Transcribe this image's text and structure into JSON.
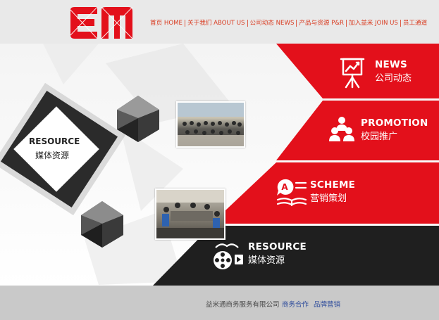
{
  "header": {
    "nav": [
      {
        "label": "首页 HOME"
      },
      {
        "label": "关于我们 ABOUT US"
      },
      {
        "label": "公司动态 NEWS"
      },
      {
        "label": "产品与资源 P&R"
      },
      {
        "label": "加入益米 JOIN US"
      },
      {
        "label": "员工通道"
      }
    ]
  },
  "panels": {
    "news": {
      "title": "NEWS",
      "subtitle": "公司动态"
    },
    "promotion": {
      "title": "PROMOTION",
      "subtitle": "校园推广"
    },
    "scheme": {
      "title": "SCHEME",
      "subtitle": "营销策划"
    },
    "resource": {
      "title": "RESOURCE",
      "subtitle": "媒体资源"
    }
  },
  "resource_block": {
    "title": "RESOURCE",
    "subtitle": "媒体资源"
  },
  "footer": {
    "company": "益米通商务服务有限公司",
    "links": [
      {
        "label": "商务合作"
      },
      {
        "label": "品牌营销"
      }
    ]
  },
  "colors": {
    "accent_red": "#e3101b",
    "dark": "#222222",
    "nav_text": "#d93a1f",
    "footer_bg": "#c9c9c9",
    "footer_link": "#2f4d9c"
  },
  "icons": {
    "news": "presentation-board-icon",
    "promotion": "people-group-icon",
    "scheme": "speech-book-icon",
    "resource": "film-camera-icon"
  }
}
